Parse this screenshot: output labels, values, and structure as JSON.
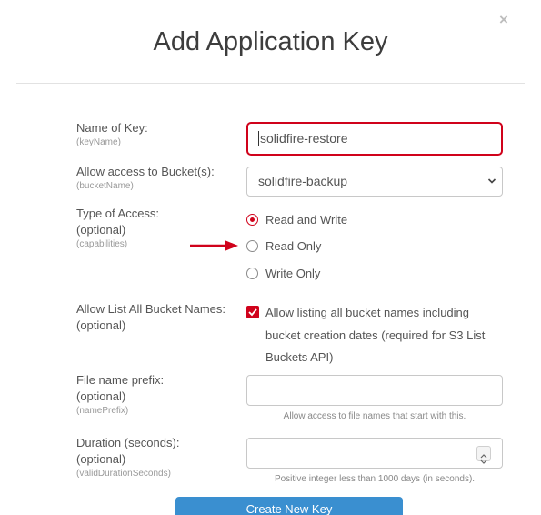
{
  "dialog": {
    "title": "Add Application Key",
    "close_label": "×"
  },
  "key_name": {
    "label": "Name of Key:",
    "sub": "(keyName)",
    "value": "solidfire-restore"
  },
  "bucket": {
    "label": "Allow access to Bucket(s):",
    "sub": "(bucketName)",
    "selected": "solidfire-backup"
  },
  "access": {
    "label": "Type of Access:",
    "optional": "(optional)",
    "sub": "(capabilities)",
    "options": [
      {
        "label": "Read and Write",
        "checked": true
      },
      {
        "label": "Read Only",
        "checked": false
      },
      {
        "label": "Write Only",
        "checked": false
      }
    ]
  },
  "list_buckets": {
    "label": "Allow List All Bucket Names:",
    "optional": "(optional)",
    "checked": true,
    "text": "Allow listing all bucket names including bucket creation dates (required for S3 List Buckets API)"
  },
  "prefix": {
    "label": "File name prefix:",
    "optional": "(optional)",
    "sub": "(namePrefix)",
    "value": "",
    "help": "Allow access to file names that start with this."
  },
  "duration": {
    "label": "Duration (seconds):",
    "optional": "(optional)",
    "sub": "(validDurationSeconds)",
    "value": "",
    "help": "Positive integer less than 1000 days (in seconds)."
  },
  "submit_label": "Create New Key",
  "colors": {
    "accent": "#d0021b",
    "button": "#3a8fd0"
  },
  "icons": [
    "close-icon",
    "chevron-down-icon",
    "arrow-icon",
    "checkmark-icon",
    "spinner-icon"
  ]
}
